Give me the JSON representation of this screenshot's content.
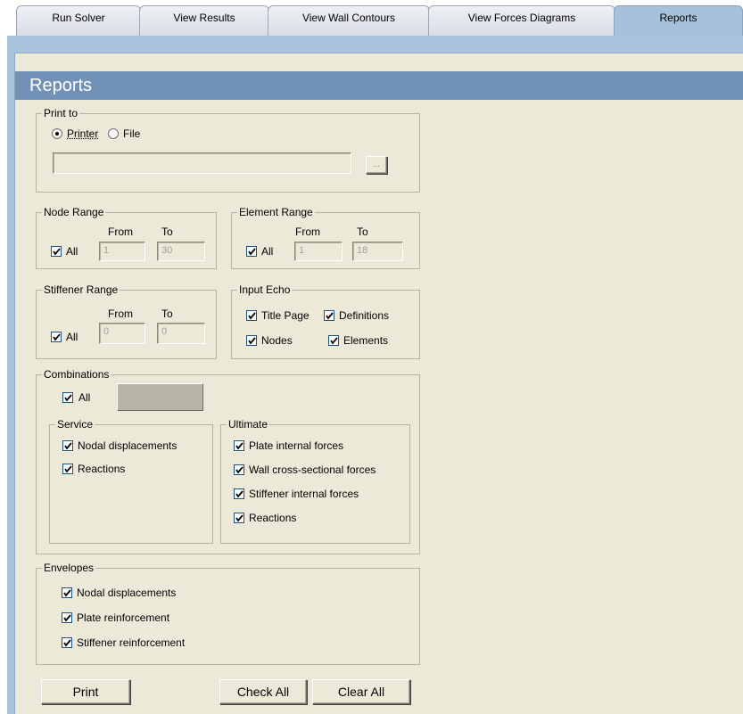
{
  "tabs": [
    "Run Solver",
    "View Results",
    "View Wall Contours",
    "View Forces Diagrams",
    "Reports"
  ],
  "header_title": "Reports",
  "print_to": {
    "legend": "Print to",
    "printer_label": "Printer",
    "file_label": "File",
    "selected": "Printer",
    "file_path": "",
    "browse_label": "..."
  },
  "node_range": {
    "legend": "Node Range",
    "all_label": "All",
    "from_label": "From",
    "to_label": "To",
    "from": "1",
    "to": "30"
  },
  "element_range": {
    "legend": "Element Range",
    "all_label": "All",
    "from_label": "From",
    "to_label": "To",
    "from": "1",
    "to": "18"
  },
  "stiffener_range": {
    "legend": "Stiffener Range",
    "all_label": "All",
    "from_label": "From",
    "to_label": "To",
    "from": "0",
    "to": "0"
  },
  "input_echo": {
    "legend": "Input Echo",
    "title_page": "Title Page",
    "definitions": "Definitions",
    "nodes": "Nodes",
    "elements": "Elements"
  },
  "combinations": {
    "legend": "Combinations",
    "all_label": "All",
    "service": {
      "legend": "Service",
      "items": [
        "Nodal displacements",
        "Reactions"
      ]
    },
    "ultimate": {
      "legend": "Ultimate",
      "items": [
        "Plate internal forces",
        "Wall cross-sectional forces",
        "Stiffener internal forces",
        "Reactions"
      ]
    }
  },
  "envelopes": {
    "legend": "Envelopes",
    "items": [
      "Nodal displacements",
      "Plate reinforcement",
      "Stiffener reinforcement"
    ]
  },
  "buttons": {
    "print": "Print",
    "check_all": "Check All",
    "clear_all": "Clear All"
  }
}
